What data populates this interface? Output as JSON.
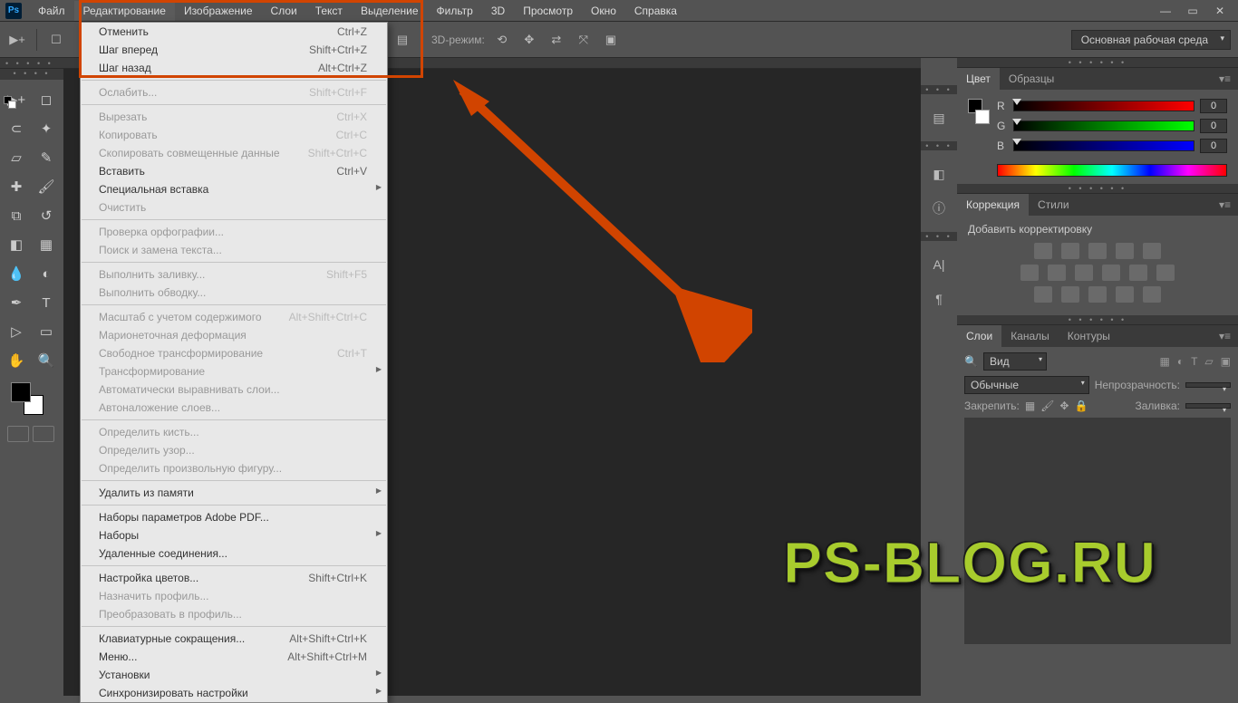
{
  "menubar": {
    "items": [
      "Файл",
      "Редактирование",
      "Изображение",
      "Слои",
      "Текст",
      "Выделение",
      "Фильтр",
      "3D",
      "Просмотр",
      "Окно",
      "Справка"
    ],
    "active_index": 1
  },
  "workspace_dropdown": "Основная рабочая среда",
  "optbar_3d_label": "3D-режим:",
  "dropdown": {
    "groups": [
      [
        {
          "label": "Отменить",
          "shortcut": "Ctrl+Z"
        },
        {
          "label": "Шаг вперед",
          "shortcut": "Shift+Ctrl+Z"
        },
        {
          "label": "Шаг назад",
          "shortcut": "Alt+Ctrl+Z"
        }
      ],
      [
        {
          "label": "Ослабить...",
          "shortcut": "Shift+Ctrl+F",
          "disabled": true
        }
      ],
      [
        {
          "label": "Вырезать",
          "shortcut": "Ctrl+X",
          "disabled": true
        },
        {
          "label": "Копировать",
          "shortcut": "Ctrl+C",
          "disabled": true
        },
        {
          "label": "Скопировать совмещенные данные",
          "shortcut": "Shift+Ctrl+C",
          "disabled": true
        },
        {
          "label": "Вставить",
          "shortcut": "Ctrl+V"
        },
        {
          "label": "Специальная вставка",
          "sub": true
        },
        {
          "label": "Очистить",
          "disabled": true
        }
      ],
      [
        {
          "label": "Проверка орфографии...",
          "disabled": true
        },
        {
          "label": "Поиск и замена текста...",
          "disabled": true
        }
      ],
      [
        {
          "label": "Выполнить заливку...",
          "shortcut": "Shift+F5",
          "disabled": true
        },
        {
          "label": "Выполнить обводку...",
          "disabled": true
        }
      ],
      [
        {
          "label": "Масштаб с учетом содержимого",
          "shortcut": "Alt+Shift+Ctrl+C",
          "disabled": true
        },
        {
          "label": "Марионеточная деформация",
          "disabled": true
        },
        {
          "label": "Свободное трансформирование",
          "shortcut": "Ctrl+T",
          "disabled": true
        },
        {
          "label": "Трансформирование",
          "sub": true,
          "disabled": true
        },
        {
          "label": "Автоматически выравнивать слои...",
          "disabled": true
        },
        {
          "label": "Автоналожение слоев...",
          "disabled": true
        }
      ],
      [
        {
          "label": "Определить кисть...",
          "disabled": true
        },
        {
          "label": "Определить узор...",
          "disabled": true
        },
        {
          "label": "Определить произвольную фигуру...",
          "disabled": true
        }
      ],
      [
        {
          "label": "Удалить из памяти",
          "sub": true
        }
      ],
      [
        {
          "label": "Наборы параметров Adobe PDF..."
        },
        {
          "label": "Наборы",
          "sub": true
        },
        {
          "label": "Удаленные соединения..."
        }
      ],
      [
        {
          "label": "Настройка цветов...",
          "shortcut": "Shift+Ctrl+K"
        },
        {
          "label": "Назначить профиль...",
          "disabled": true
        },
        {
          "label": "Преобразовать в профиль...",
          "disabled": true
        }
      ],
      [
        {
          "label": "Клавиатурные сокращения...",
          "shortcut": "Alt+Shift+Ctrl+K"
        },
        {
          "label": "Меню...",
          "shortcut": "Alt+Shift+Ctrl+M"
        },
        {
          "label": "Установки",
          "sub": true
        },
        {
          "label": "Синхронизировать настройки",
          "sub": true
        }
      ]
    ]
  },
  "color_panel": {
    "tab_color": "Цвет",
    "tab_swatches": "Образцы",
    "r": {
      "label": "R",
      "value": "0"
    },
    "g": {
      "label": "G",
      "value": "0"
    },
    "b": {
      "label": "B",
      "value": "0"
    }
  },
  "corrections_panel": {
    "tab_corr": "Коррекция",
    "tab_styles": "Стили",
    "title": "Добавить корректировку"
  },
  "layers_panel": {
    "tab_layers": "Слои",
    "tab_channels": "Каналы",
    "tab_paths": "Контуры",
    "filter_label": "Вид",
    "blend_label": "Обычные",
    "opacity_label": "Непрозрачность:",
    "lock_label": "Закрепить:",
    "fill_label": "Заливка:"
  },
  "watermark": "PS-BLOG.RU"
}
